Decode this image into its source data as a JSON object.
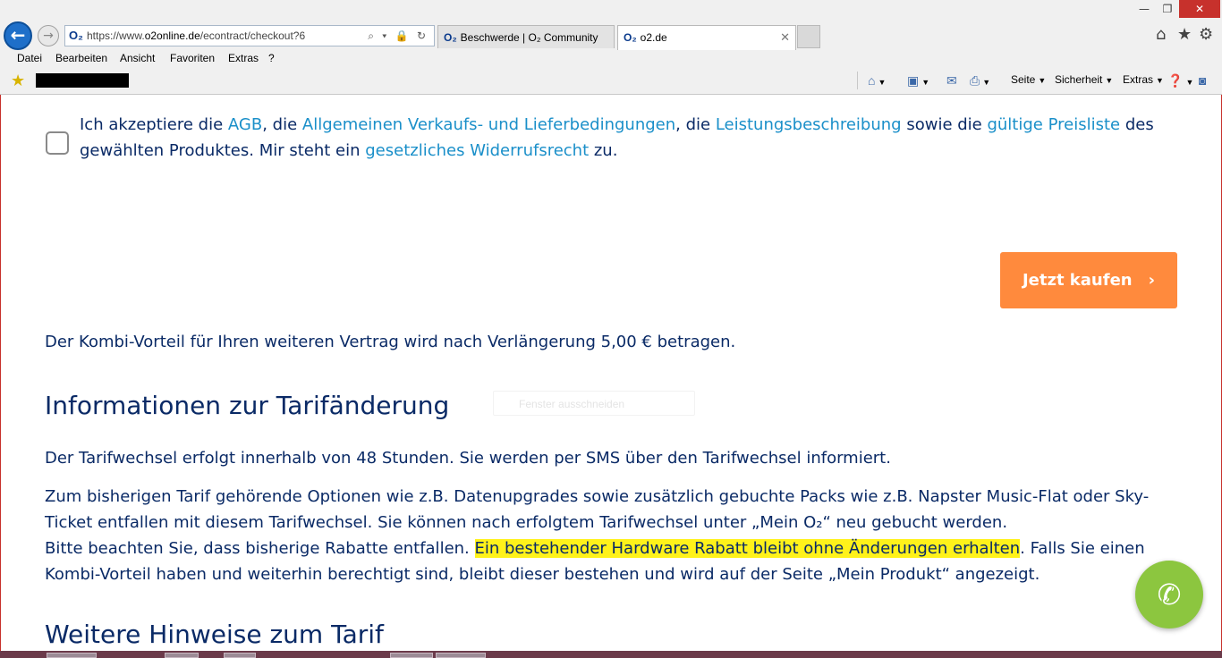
{
  "window": {
    "minimize_glyph": "—",
    "maximize_glyph": "❐",
    "close_glyph": "✕"
  },
  "nav": {
    "back_glyph": "←",
    "forward_glyph": "→"
  },
  "address": {
    "favicon": "O₂",
    "url_prefix": "https://www.",
    "url_domain": "o2online.de",
    "url_path": "/econtract/checkout?6",
    "icons": "⌕ ▾ 🔒 ↻"
  },
  "tabs": [
    {
      "favicon": "O₂",
      "label": "Beschwerde | O₂ Community"
    },
    {
      "favicon": "O₂",
      "label": "o2.de",
      "close": "✕"
    }
  ],
  "toolbar_icons": {
    "home": "⌂",
    "favorites": "★",
    "tools": "⚙"
  },
  "menu": [
    "Datei",
    "Bearbeiten",
    "Ansicht",
    "Favoriten",
    "Extras",
    "?"
  ],
  "command_bar": {
    "page": "Seite",
    "safety": "Sicherheit",
    "tools": "Extras"
  },
  "content": {
    "terms": {
      "t1": "Ich akzeptiere die ",
      "agb": "AGB",
      "t2": ", die ",
      "avl": "Allgemeinen Verkaufs- und Lieferbedingungen",
      "t3": ", die ",
      "lb": "Leistungsbeschreibung",
      "t4": " sowie die ",
      "pl": "gültige Preisliste",
      "t5": " des gewählten Produktes. Mir steht ein ",
      "wr": "gesetzliches Widerrufsrecht",
      "t6": " zu."
    },
    "buy_button": "Jetzt kaufen",
    "buy_chevron": "›",
    "kombi_text": "Der Kombi-Vorteil für Ihren weiteren Vertrag wird nach Verlängerung 5,00 € betragen.",
    "heading_info": "Informationen zur Tarifänderung",
    "ghost_label": "Fenster ausschneiden",
    "p1": "Der Tarifwechsel erfolgt innerhalb von 48 Stunden. Sie werden per SMS über den Tarifwechsel informiert.",
    "p2a": "Zum bisherigen Tarif gehörende Optionen wie z.B. Datenupgrades sowie zusätzlich gebuchte Packs wie z.B. Napster Music-Flat oder Sky-Ticket entfallen mit diesem Tarifwechsel. Sie können nach erfolgtem Tarifwechsel unter „Mein O₂“ neu gebucht werden.",
    "p2b": "Bitte beachten Sie, dass bisherige Rabatte entfallen. ",
    "p2_highlight": "Ein bestehender Hardware Rabatt bleibt ohne Änderungen erhalten",
    "p2c": ". Falls Sie einen Kombi-Vorteil haben und weiterhin berechtigt sind, bleibt dieser bestehen und wird auf der Seite „Mein Produkt“ angezeigt.",
    "heading_weitere": "Weitere Hinweise zum Tarif",
    "call_glyph": "✆"
  },
  "colors": {
    "brand_navy": "#0a2a66",
    "link_blue": "#1a8fc9",
    "buy_orange": "#ff8a3d",
    "call_green": "#8cc63f",
    "highlight_yellow": "#fff21a"
  }
}
